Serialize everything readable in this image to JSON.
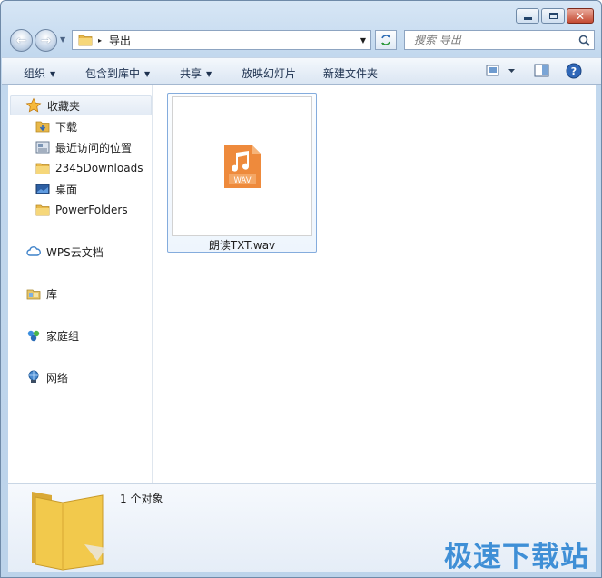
{
  "window": {
    "caption_buttons": [
      "minimize",
      "maximize",
      "close"
    ]
  },
  "address_bar": {
    "path": "导出",
    "breadcrumb_separator": "▸"
  },
  "search": {
    "placeholder": "搜索 导出"
  },
  "toolbar": {
    "organize": "组织",
    "include_in_library": "包含到库中",
    "share": "共享",
    "slideshow": "放映幻灯片",
    "new_folder": "新建文件夹"
  },
  "navigation": {
    "favorites_label": "收藏夹",
    "favorites": [
      {
        "label": "下载",
        "icon": "download-folder-icon"
      },
      {
        "label": "最近访问的位置",
        "icon": "recent-places-icon"
      },
      {
        "label": "2345Downloads",
        "icon": "folder-icon"
      },
      {
        "label": "桌面",
        "icon": "desktop-icon"
      },
      {
        "label": "PowerFolders",
        "icon": "folder-icon"
      }
    ],
    "wps_cloud": "WPS云文档",
    "library": "库",
    "homegroup": "家庭组",
    "network": "网络"
  },
  "files": [
    {
      "name": "朗读TXT.wav",
      "type_label": "WAV",
      "icon_color": "#ee8a3c"
    }
  ],
  "details": {
    "count": "1 个对象"
  },
  "watermark": "极速下载站",
  "colors": {
    "accent": "#3f8fd6",
    "wav_orange": "#ee8a3c",
    "folder_yellow": "#f2c94c"
  }
}
